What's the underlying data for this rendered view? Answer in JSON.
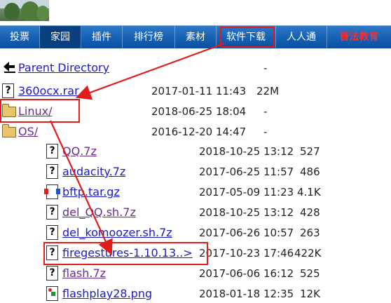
{
  "nav": {
    "items": [
      {
        "label": "投票"
      },
      {
        "label": "家园"
      },
      {
        "label": "插件"
      },
      {
        "label": "排行榜"
      },
      {
        "label": "素材"
      },
      {
        "label": "软件下载"
      },
      {
        "label": "人人通"
      },
      {
        "label": "普法教育"
      }
    ]
  },
  "listing": {
    "parent": {
      "label": "Parent Directory",
      "size": "-"
    },
    "top": [
      {
        "name": "360ocx.rar",
        "date": "2017-01-11 11:43",
        "size": "22M",
        "icon": "unknown-file-icon"
      },
      {
        "name": "Linux/",
        "date": "2018-06-25 18:04",
        "size": "-",
        "icon": "folder-icon"
      },
      {
        "name": "OS/",
        "date": "2016-12-20 14:47",
        "size": "-",
        "icon": "folder-icon"
      }
    ],
    "sub": [
      {
        "name": "QQ.7z",
        "date": "2018-10-25 13:12",
        "size": "527",
        "icon": "unknown-file-icon"
      },
      {
        "name": "audacity.7z",
        "date": "2017-06-25 11:57",
        "size": "486",
        "icon": "unknown-file-icon"
      },
      {
        "name": "bftp.tar.gz",
        "date": "2017-05-09 11:23",
        "size": "4.1K",
        "icon": "archive-icon"
      },
      {
        "name": "del_QQ.sh.7z",
        "date": "2018-10-25 13:12",
        "size": "428",
        "icon": "unknown-file-icon"
      },
      {
        "name": "del_komoozer.sh.7z",
        "date": "2017-06-26 10:57",
        "size": "263",
        "icon": "unknown-file-icon"
      },
      {
        "name": "firegestures-1.10.13..>",
        "date": "2017-10-23 17:46",
        "size": "422K",
        "icon": "unknown-file-icon"
      },
      {
        "name": "flash.7z",
        "date": "2017-06-06 16:12",
        "size": "525",
        "icon": "unknown-file-icon"
      },
      {
        "name": "flashplay28.png",
        "date": "2018-01-18 12:35",
        "size": "12K",
        "icon": "image-icon"
      }
    ]
  },
  "colors": {
    "nav_bg": "#1560b3",
    "link": "#1a1acc",
    "visited": "#6b2c8f",
    "annotation": "#e21b1b",
    "nav_red": "#ff2a2a"
  }
}
